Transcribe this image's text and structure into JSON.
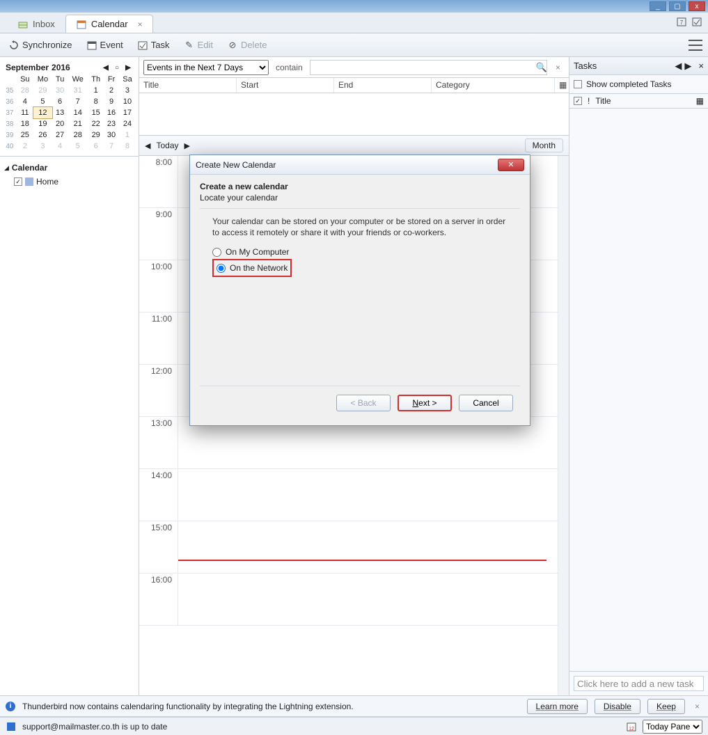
{
  "window": {
    "min": "_",
    "max": "▢",
    "close": "x"
  },
  "tabs": {
    "inbox": "Inbox",
    "calendar": "Calendar"
  },
  "toolbar": {
    "sync": "Synchronize",
    "event": "Event",
    "task": "Task",
    "edit": "Edit",
    "delete": "Delete"
  },
  "mini": {
    "month": "September",
    "year": "2016",
    "dow": [
      "Su",
      "Mo",
      "Tu",
      "We",
      "Th",
      "Fr",
      "Sa"
    ],
    "weeks": [
      {
        "wk": "35",
        "d": [
          "28",
          "29",
          "30",
          "31",
          "1",
          "2",
          "3"
        ],
        "other": [
          0,
          1,
          2,
          3
        ]
      },
      {
        "wk": "36",
        "d": [
          "4",
          "5",
          "6",
          "7",
          "8",
          "9",
          "10"
        ]
      },
      {
        "wk": "37",
        "d": [
          "11",
          "12",
          "13",
          "14",
          "15",
          "16",
          "17"
        ],
        "today": 1
      },
      {
        "wk": "38",
        "d": [
          "18",
          "19",
          "20",
          "21",
          "22",
          "23",
          "24"
        ]
      },
      {
        "wk": "39",
        "d": [
          "25",
          "26",
          "27",
          "28",
          "29",
          "30",
          "1"
        ],
        "other": [
          6
        ]
      },
      {
        "wk": "40",
        "d": [
          "2",
          "3",
          "4",
          "5",
          "6",
          "7",
          "8"
        ],
        "other": [
          0,
          1,
          2,
          3,
          4,
          5,
          6
        ]
      }
    ]
  },
  "caltree": {
    "root": "Calendar",
    "item": "Home"
  },
  "filter": {
    "preset": "Events in the Next 7 Days",
    "contain": "contain"
  },
  "cols": {
    "title": "Title",
    "start": "Start",
    "end": "End",
    "category": "Category"
  },
  "daybar": {
    "today": "Today",
    "month": "Month"
  },
  "hours": [
    "8:00",
    "9:00",
    "10:00",
    "11:00",
    "12:00",
    "13:00",
    "14:00",
    "15:00",
    "16:00"
  ],
  "tasks": {
    "header": "Tasks",
    "show": "Show completed Tasks",
    "title": "Title",
    "add": "Click here to add a new task"
  },
  "dialog": {
    "title": "Create New Calendar",
    "h": "Create a new calendar",
    "sub": "Locate your calendar",
    "msg": "Your calendar can be stored on your computer or be stored on a server in order to access it remotely or share it with your friends or co-workers.",
    "r1": "On My Computer",
    "r2": "On the Network",
    "back": "< Back",
    "next": "Next >",
    "cancel": "Cancel"
  },
  "info": {
    "msg": "Thunderbird now contains calendaring functionality by integrating the Lightning extension.",
    "learn": "Learn more",
    "disable": "Disable",
    "keep": "Keep"
  },
  "status": {
    "msg": "support@mailmaster.co.th is up to date",
    "today": "Today Pane"
  }
}
